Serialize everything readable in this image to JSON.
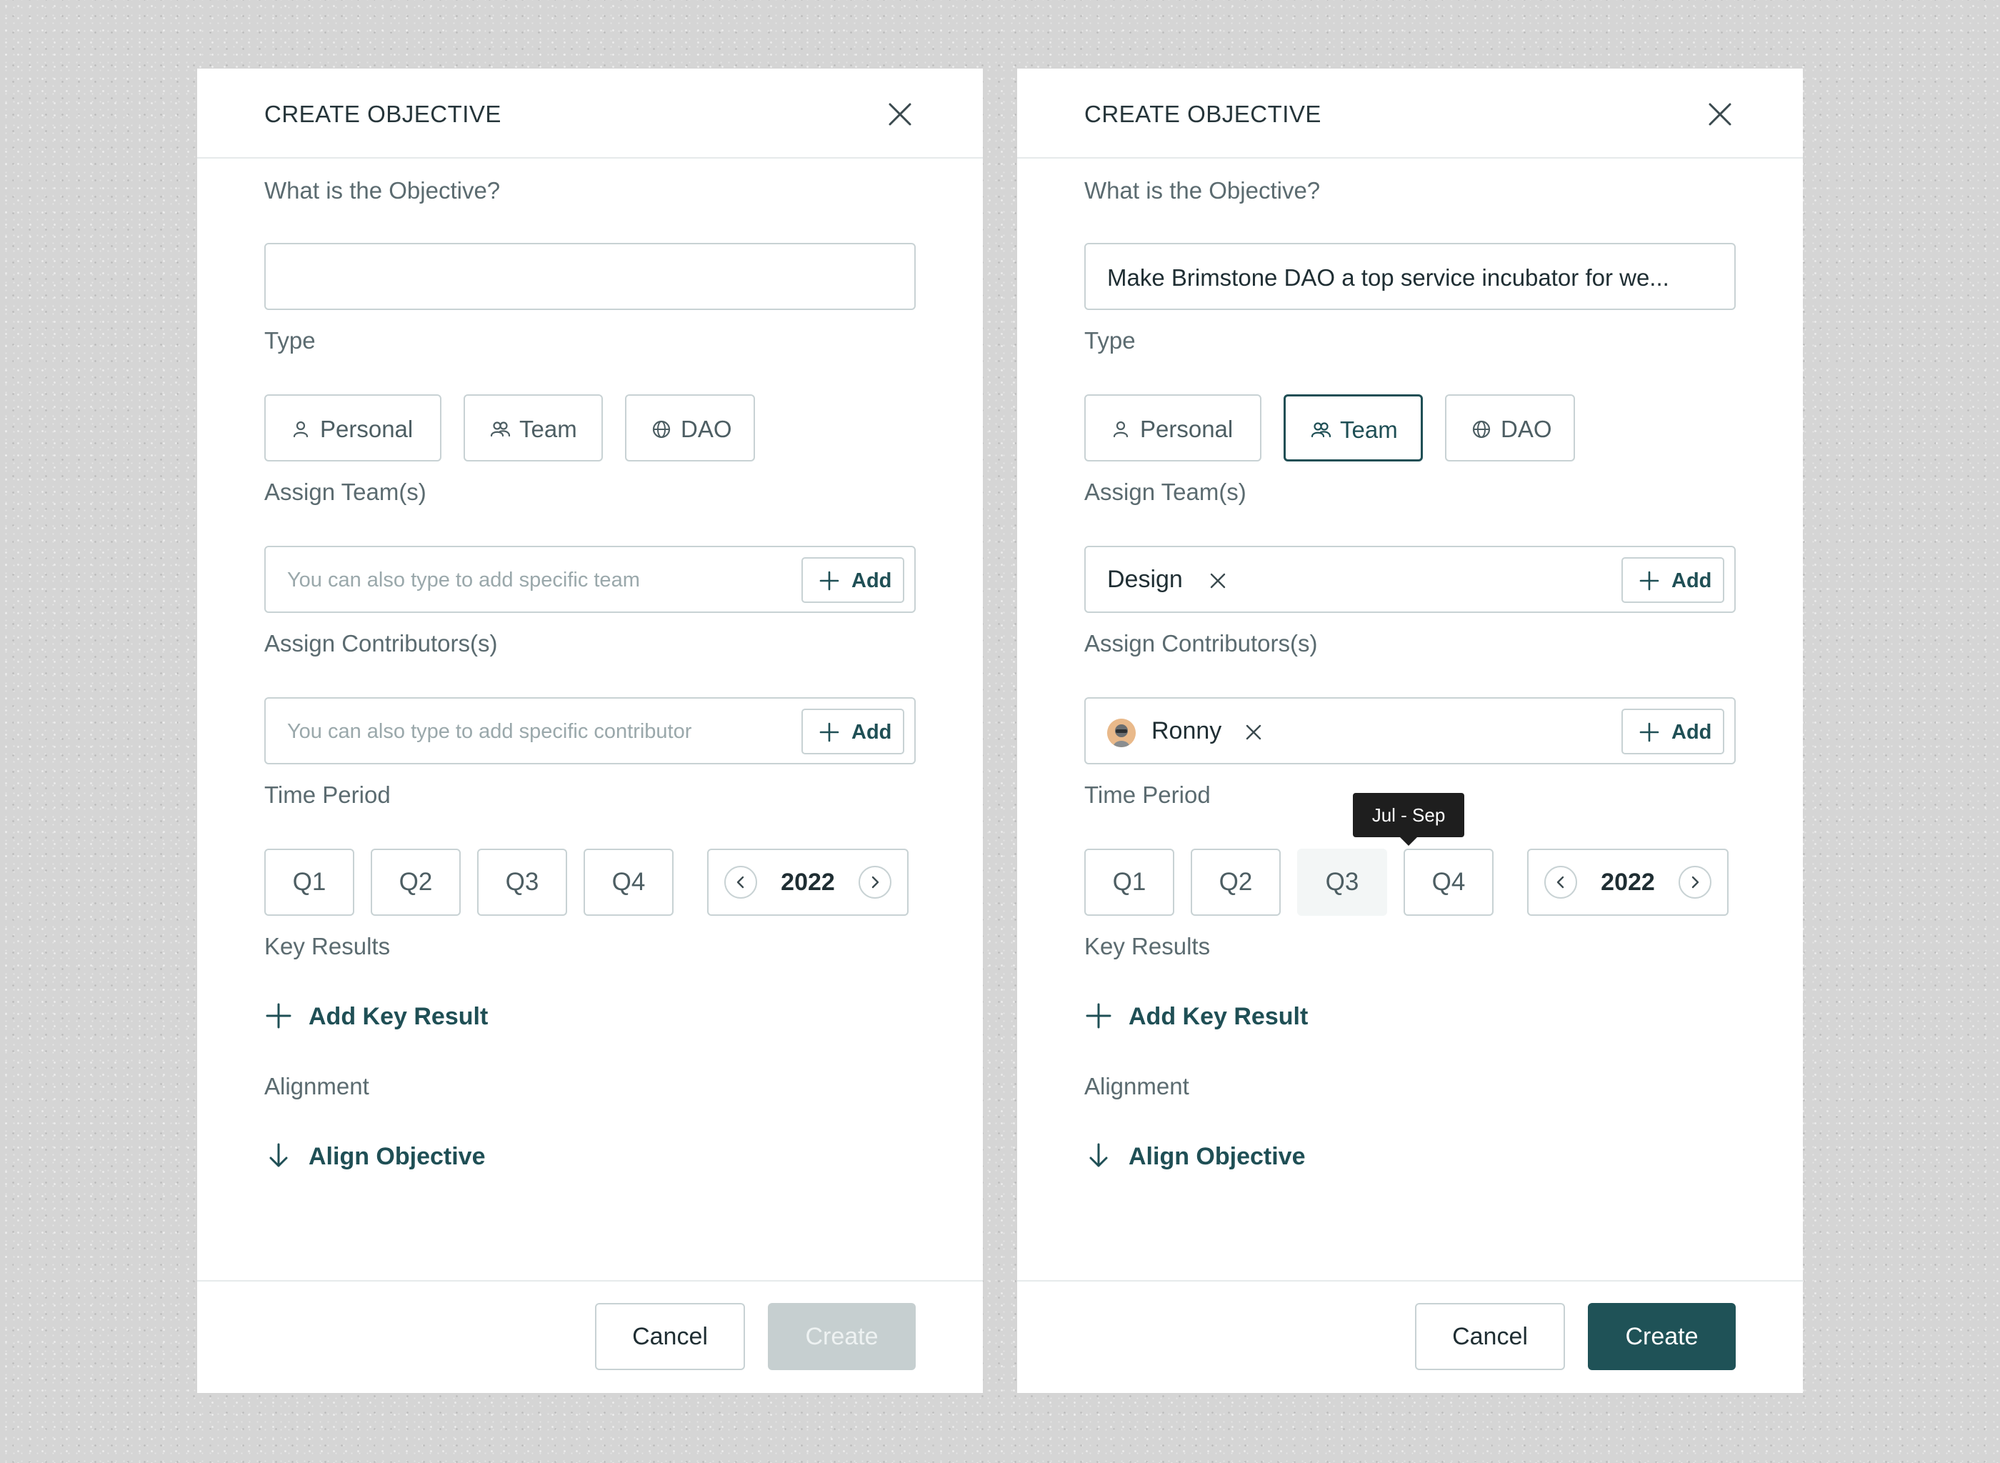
{
  "left": {
    "header": {
      "title": "CREATE OBJECTIVE"
    },
    "objective": {
      "label": "What is the Objective?",
      "value": ""
    },
    "type": {
      "label": "Type",
      "options": [
        {
          "label": "Personal",
          "icon": "person-icon",
          "selected": false
        },
        {
          "label": "Team",
          "icon": "team-icon",
          "selected": false
        },
        {
          "label": "DAO",
          "icon": "globe-icon",
          "selected": false
        }
      ]
    },
    "teams": {
      "label": "Assign Team(s)",
      "placeholder": "You can also type to add specific team",
      "add_label": "Add"
    },
    "contributors": {
      "label": "Assign Contributors(s)",
      "placeholder": "You can also type to add specific contributor",
      "add_label": "Add"
    },
    "time_period": {
      "label": "Time Period",
      "quarters": [
        "Q1",
        "Q2",
        "Q3",
        "Q4"
      ],
      "year": "2022"
    },
    "key_results": {
      "label": "Key Results",
      "link": "Add Key Result"
    },
    "alignment": {
      "label": "Alignment",
      "link": "Align Objective"
    },
    "footer": {
      "cancel": "Cancel",
      "create": "Create",
      "create_enabled": false
    }
  },
  "right": {
    "header": {
      "title": "CREATE OBJECTIVE"
    },
    "objective": {
      "label": "What is the Objective?",
      "value": "Make Brimstone DAO a top service incubator for we..."
    },
    "type": {
      "label": "Type",
      "options": [
        {
          "label": "Personal",
          "icon": "person-icon",
          "selected": false
        },
        {
          "label": "Team",
          "icon": "team-icon",
          "selected": true
        },
        {
          "label": "DAO",
          "icon": "globe-icon",
          "selected": false
        }
      ]
    },
    "teams": {
      "label": "Assign Team(s)",
      "chip": "Design",
      "add_label": "Add"
    },
    "contributors": {
      "label": "Assign Contributors(s)",
      "chip": "Ronny",
      "add_label": "Add"
    },
    "time_period": {
      "label": "Time Period",
      "quarters": [
        "Q1",
        "Q2",
        "Q3",
        "Q4"
      ],
      "hovered": "Q3",
      "tooltip": "Jul - Sep",
      "year": "2022"
    },
    "key_results": {
      "label": "Key Results",
      "link": "Add Key Result"
    },
    "alignment": {
      "label": "Alignment",
      "link": "Align Objective"
    },
    "footer": {
      "cancel": "Cancel",
      "create": "Create",
      "create_enabled": true
    }
  },
  "colors": {
    "accent": "#1f5257",
    "border": "#c8d2d4",
    "disabled": "#c6cfd0"
  }
}
